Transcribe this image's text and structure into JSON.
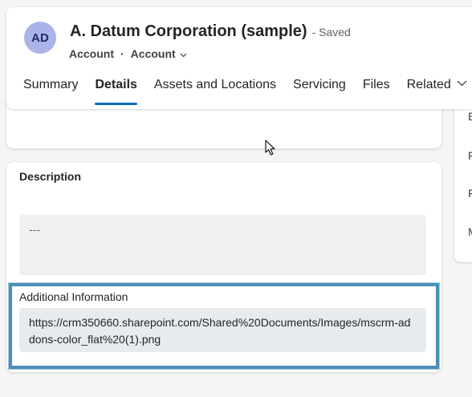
{
  "record": {
    "avatar_initials": "AD",
    "title": "A. Datum Corporation (sample)",
    "save_status": "- Saved",
    "entity": "Account",
    "separator": "·",
    "form_selector": "Account"
  },
  "tabs": [
    {
      "label": "Summary",
      "active": false
    },
    {
      "label": "Details",
      "active": true
    },
    {
      "label": "Assets and Locations",
      "active": false
    },
    {
      "label": "Servicing",
      "active": false
    },
    {
      "label": "Files",
      "active": false
    },
    {
      "label": "Related",
      "active": false
    }
  ],
  "side_panel": {
    "letters": [
      "E",
      "F",
      "F",
      "M"
    ]
  },
  "description_section": {
    "label": "Description",
    "value": "---"
  },
  "additional_information": {
    "label": "Additional Information",
    "value": "https://crm350660.sharepoint.com/Shared%20Documents/Images/mscrm-addons-color_flat%20(1).png"
  },
  "colors": {
    "accent": "#0f6cbd",
    "avatar_bg": "#aab4e8",
    "highlight_border": "#4a90b8"
  }
}
